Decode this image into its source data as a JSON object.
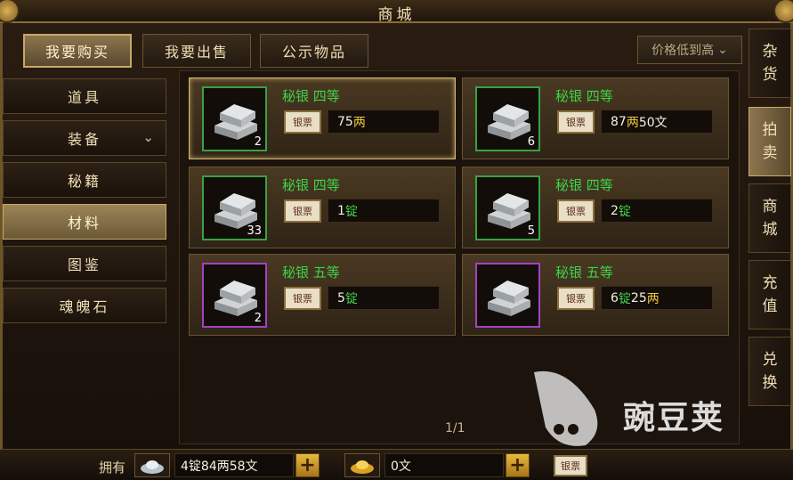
{
  "title": "商城",
  "top_tabs": [
    {
      "label": "我要购买",
      "active": true
    },
    {
      "label": "我要出售",
      "active": false
    },
    {
      "label": "公示物品",
      "active": false
    }
  ],
  "sort": {
    "label": "价格低到高",
    "icon": "chevron-down-icon"
  },
  "left_menu": [
    {
      "label": "道具",
      "active": false
    },
    {
      "label": "装备",
      "active": false,
      "has_dropdown": true
    },
    {
      "label": "秘籍",
      "active": false
    },
    {
      "label": "材料",
      "active": true
    },
    {
      "label": "图鉴",
      "active": false
    },
    {
      "label": "魂魄石",
      "active": false
    }
  ],
  "items": [
    {
      "name": "秘银 四等",
      "count": "2",
      "rarity_color": "#3aa142",
      "currency_label": "银票",
      "price": [
        {
          "v": "75",
          "c": "u-wen"
        },
        {
          "v": "两",
          "c": "u-liang"
        }
      ],
      "selected": true
    },
    {
      "name": "秘银 四等",
      "count": "6",
      "rarity_color": "#3aa142",
      "currency_label": "银票",
      "price": [
        {
          "v": "87",
          "c": "u-wen"
        },
        {
          "v": "两",
          "c": "u-liang"
        },
        {
          "v": "50文",
          "c": "u-wen"
        }
      ],
      "selected": false
    },
    {
      "name": "秘银 四等",
      "count": "33",
      "rarity_color": "#3aa142",
      "currency_label": "银票",
      "price": [
        {
          "v": "1",
          "c": "u-wen"
        },
        {
          "v": "锭",
          "c": "u-ding"
        }
      ],
      "selected": false
    },
    {
      "name": "秘银 四等",
      "count": "5",
      "rarity_color": "#3aa142",
      "currency_label": "银票",
      "price": [
        {
          "v": "2",
          "c": "u-wen"
        },
        {
          "v": "锭",
          "c": "u-ding"
        }
      ],
      "selected": false
    },
    {
      "name": "秘银 五等",
      "count": "2",
      "rarity_color": "#a640c4",
      "currency_label": "银票",
      "price": [
        {
          "v": "5",
          "c": "u-wen"
        },
        {
          "v": "锭",
          "c": "u-ding"
        }
      ],
      "selected": false
    },
    {
      "name": "秘银 五等",
      "count": "",
      "rarity_color": "#a640c4",
      "currency_label": "银票",
      "price": [
        {
          "v": "6",
          "c": "u-wen"
        },
        {
          "v": "锭",
          "c": "u-ding"
        },
        {
          "v": "25",
          "c": "u-wen"
        },
        {
          "v": "两",
          "c": "u-liang"
        }
      ],
      "selected": false
    }
  ],
  "pager": "1/1",
  "right_tabs": [
    {
      "label": [
        "杂",
        "货"
      ],
      "active": false
    },
    {
      "label": [
        "拍",
        "卖"
      ],
      "active": true
    },
    {
      "label": [
        "商",
        "城"
      ],
      "active": false
    },
    {
      "label": [
        "充",
        "值"
      ],
      "active": false
    },
    {
      "label": [
        "兑",
        "换"
      ],
      "active": false
    }
  ],
  "bottom": {
    "own_label": "拥有",
    "silver_value": "4锭84两58文",
    "gold_value": "0文",
    "seal_label": "银票"
  },
  "watermark_text": "豌豆荚"
}
